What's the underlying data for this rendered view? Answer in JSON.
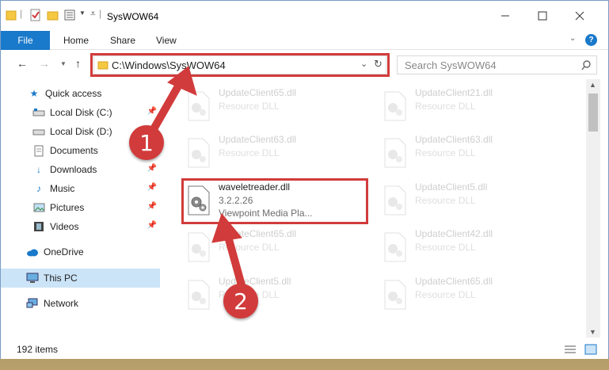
{
  "window": {
    "title": "SysWOW64"
  },
  "ribbon": {
    "file": "File",
    "home": "Home",
    "share": "Share",
    "view": "View",
    "help": "?"
  },
  "address": {
    "path": "C:\\Windows\\SysWOW64"
  },
  "search": {
    "placeholder": "Search SysWOW64"
  },
  "sidebar": {
    "items": [
      {
        "label": "Quick access",
        "icon": "star-icon"
      },
      {
        "label": "Local Disk (C:)",
        "icon": "drive-icon"
      },
      {
        "label": "Local Disk (D:)",
        "icon": "drive-icon"
      },
      {
        "label": "Documents",
        "icon": "documents-icon"
      },
      {
        "label": "Downloads",
        "icon": "download-icon"
      },
      {
        "label": "Music",
        "icon": "music-icon"
      },
      {
        "label": "Pictures",
        "icon": "pictures-icon"
      },
      {
        "label": "Videos",
        "icon": "videos-icon"
      },
      {
        "label": "OneDrive",
        "icon": "cloud-icon"
      },
      {
        "label": "This PC",
        "icon": "computer-icon"
      },
      {
        "label": "Network",
        "icon": "network-icon"
      }
    ]
  },
  "files": [
    {
      "name": "UpdateClient65.dll",
      "type": "Resource DLL"
    },
    {
      "name": "UpdateClient21.dll",
      "type": "Resource DLL"
    },
    {
      "name": "UpdateClient63.dll",
      "type": "Resource DLL"
    },
    {
      "name": "UpdateClient63.dll",
      "type": "Resource DLL"
    },
    {
      "name": "waveletreader.dll",
      "version": "3.2.2.26",
      "company": "Viewpoint Media Pla..."
    },
    {
      "name": "UpdateClient5.dll",
      "type": "Resource DLL"
    },
    {
      "name": "UpdateClient65.dll",
      "type": "Resource DLL"
    },
    {
      "name": "UpdateClient42.dll",
      "type": "Resource DLL"
    },
    {
      "name": "UpdateClient5.dll",
      "type": "Resource DLL"
    },
    {
      "name": "UpdateClient65.dll",
      "type": "Resource DLL"
    }
  ],
  "status": {
    "count": "192 items"
  },
  "annotations": {
    "step1": "1",
    "step2": "2"
  },
  "colors": {
    "accent": "#1979ca",
    "highlight": "#d23b3b"
  }
}
